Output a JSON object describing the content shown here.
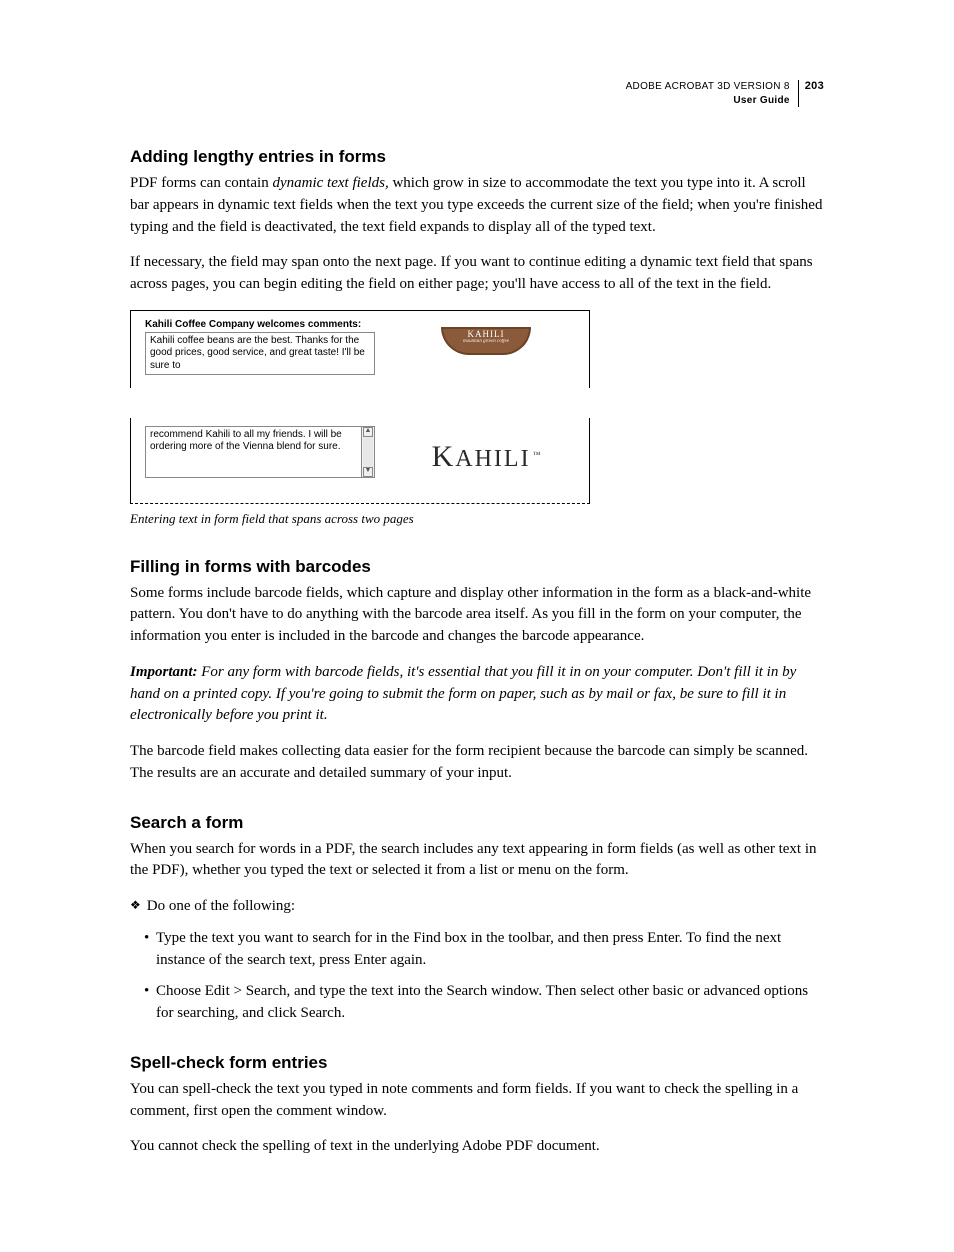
{
  "header": {
    "title": "ADOBE ACROBAT 3D VERSION 8",
    "subtitle": "User Guide",
    "page_number": "203"
  },
  "sections": [
    {
      "heading": "Adding lengthy entries in forms",
      "paragraphs": [
        {
          "pre": "PDF forms can contain ",
          "em": "dynamic text fields,",
          "post": " which grow in size to accommodate the text you type into it. A scroll bar appears in dynamic text fields when the text you type exceeds the current size of the field; when you're finished typing and the field is deactivated, the text field expands to display all of the typed text."
        },
        {
          "text": "If necessary, the field may span onto the next page. If you want to continue editing a dynamic text field that spans across pages, you can begin editing the field on either page; you'll have access to all of the text in the field."
        }
      ]
    }
  ],
  "figure": {
    "form_label": "Kahili Coffee Company welcomes comments:",
    "top_text": "Kahili coffee beans are the best. Thanks for the good prices, good service, and great taste! I'll be sure to",
    "bottom_text": "recommend Kahili to all my friends. I will be ordering more of the Vienna blend for sure.",
    "logo_top_main": "KAHILI",
    "logo_top_sub": "mountain grown coffee",
    "logo_bottom": "Kahili",
    "logo_tm": "™",
    "caption": "Entering text in form field that spans across two pages"
  },
  "section_barcodes": {
    "heading": "Filling in forms with barcodes",
    "p1": "Some forms include barcode fields, which capture and display other information in the form as a black-and-white pattern. You don't have to do anything with the barcode area itself. As you fill in the form on your computer, the information you enter is included in the barcode and changes the barcode appearance.",
    "important_label": "Important:",
    "important_text": " For any form with barcode fields, it's essential that you fill it in on your computer. Don't fill it in by hand on a printed copy. If you're going to submit the form on paper, such as by mail or fax, be sure to fill it in electronically before you print it.",
    "p2": "The barcode field makes collecting data easier for the form recipient because the barcode can simply be scanned. The results are an accurate and detailed summary of your input."
  },
  "section_search": {
    "heading": "Search a form",
    "p1": "When you search for words in a PDF, the search includes any text appearing in form fields (as well as other text in the PDF), whether you typed the text or selected it from a list or menu on the form.",
    "lead": "Do one of the following:",
    "bullets": [
      "Type the text you want to search for in the Find box in the toolbar, and then press Enter. To find the next instance of the search text, press Enter again.",
      "Choose Edit > Search, and type the text into the Search window. Then select other basic or advanced options for searching, and click Search."
    ]
  },
  "section_spell": {
    "heading": "Spell-check form entries",
    "p1": "You can spell-check the text you typed in note comments and form fields. If you want to check the spelling in a comment, first open the comment window.",
    "p2": "You cannot check the spelling of text in the underlying Adobe PDF document."
  }
}
